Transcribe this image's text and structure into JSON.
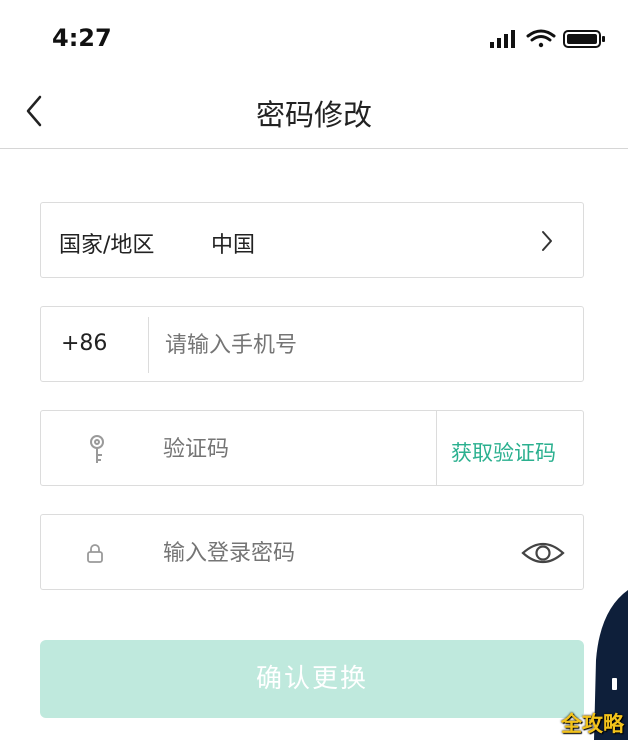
{
  "status_bar": {
    "time": "4:27"
  },
  "nav": {
    "title": "密码修改"
  },
  "form": {
    "region": {
      "label": "国家/地区",
      "value": "中国"
    },
    "phone": {
      "prefix": "+86",
      "placeholder": "请输入手机号"
    },
    "code": {
      "placeholder": "验证码",
      "get_code_label": "获取验证码"
    },
    "password": {
      "placeholder": "输入登录密码"
    },
    "confirm_label": "确认更换"
  },
  "watermark": "全攻略",
  "colors": {
    "accent": "#2bb08f",
    "button_bg": "#bfe9dd",
    "border": "#dcdcdc"
  }
}
